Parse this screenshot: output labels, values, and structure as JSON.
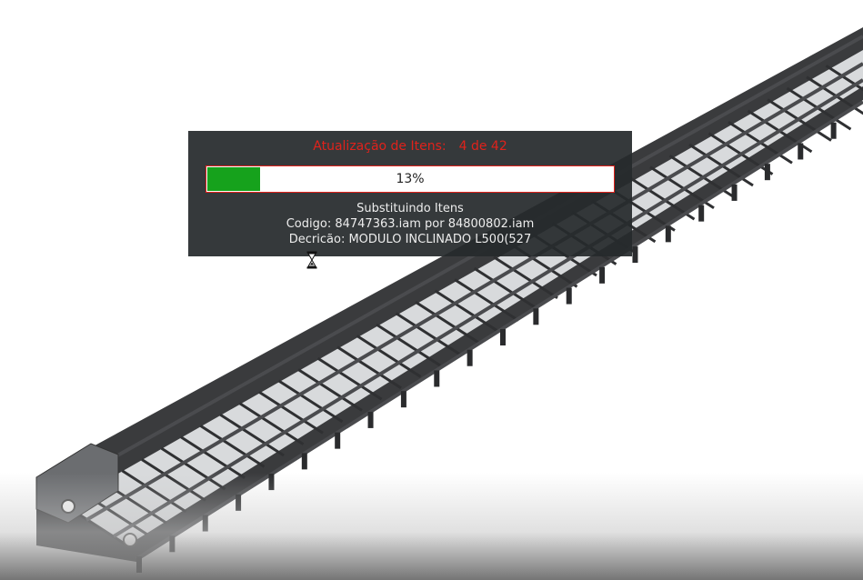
{
  "dialog": {
    "title": "Atualização de Itens:",
    "counter": "4 de 42",
    "progress_fraction": 0.13,
    "progress_label": "13%",
    "status_line": "Substituindo Itens",
    "code_line": "Codigo: 84747363.iam por 84800802.iam",
    "description_line": "Decricão: MODULO INCLINADO L500(527"
  },
  "colors": {
    "title": "#e0221b",
    "progress_fill": "#16a21c",
    "dialog_bg": "#262a2c"
  },
  "cursor": {
    "icon": "hourglass-cursor-icon"
  }
}
